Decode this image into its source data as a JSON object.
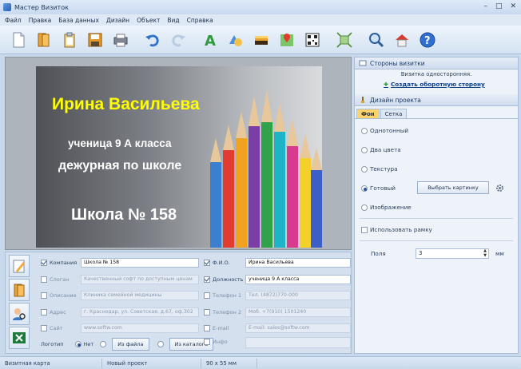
{
  "window": {
    "title": "Мастер Визиток",
    "min": "–",
    "max": "□",
    "close": "✕"
  },
  "menu": [
    "Файл",
    "Правка",
    "База данных",
    "Дизайн",
    "Объект",
    "Вид",
    "Справка"
  ],
  "card": {
    "name": "Ирина Васильева",
    "line1": "ученица 9 А класса",
    "line2": "дежурная по школе",
    "school": "Школа № 158"
  },
  "fields": {
    "company": {
      "label": "Компания",
      "value": "Школа № 158"
    },
    "slogan": {
      "label": "Слоган",
      "value": "Качественный софт по доступным ценам"
    },
    "description": {
      "label": "Описание",
      "value": "Клиника семейной медицины"
    },
    "address": {
      "label": "Адрес",
      "value": "г. Краснодар, ул. Советская, д.67, оф.302"
    },
    "site": {
      "label": "Сайт",
      "value": "www.softw.com"
    },
    "fio": {
      "label": "Ф.И.О.",
      "value": "Ирина Васильева"
    },
    "position": {
      "label": "Должность",
      "value": "ученица 9 А класса"
    },
    "phone1": {
      "label": "Телефон 1",
      "value": "Тел. (4872)770-000"
    },
    "phone2": {
      "label": "Телефон 2",
      "value": "Моб. +7(910) 1501240"
    },
    "email": {
      "label": "E-mail",
      "value": "E-mail: sales@softw.com"
    },
    "info": {
      "label": "Инфо",
      "value": ""
    },
    "logo": {
      "label": "Логотип",
      "none": "Нет",
      "from_file": "Из файла",
      "from_catalog": "Из каталога"
    }
  },
  "right_panel": {
    "sides_title": "Стороны визитки",
    "sides_info": "Визитка односторонняя.",
    "sides_link": "Создать оборотную сторону",
    "design_title": "Дизайн проекта",
    "tabs": [
      "Фон",
      "Сетка"
    ],
    "options": [
      "Однотонный",
      "Два цвета",
      "Текстура",
      "Готовый",
      "Изображение"
    ],
    "choose_picture": "Выбрать картинку",
    "use_frame": "Использовать рамку",
    "margins_label": "Поля",
    "margins_value": "3",
    "margins_unit": "мм"
  },
  "status": [
    "Визитная карта",
    "Новый проект",
    "90 х 55 мм"
  ],
  "colors": {
    "accent": "#ffd56b",
    "name_text": "#ffff00",
    "link": "#0b3f8c"
  }
}
